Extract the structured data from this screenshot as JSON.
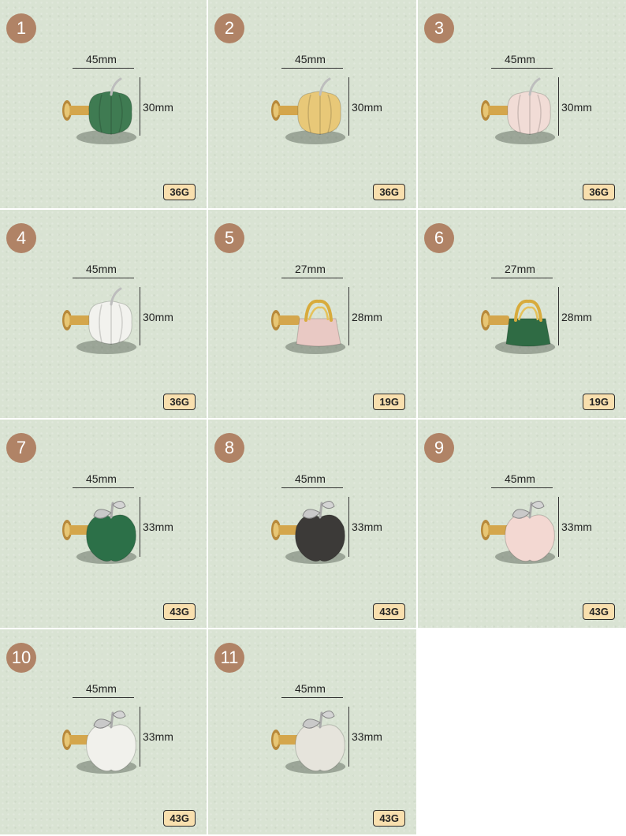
{
  "items": [
    {
      "number": "1",
      "width": "45mm",
      "height": "30mm",
      "weight": "36G",
      "shape": "pumpkin",
      "color": "#3f7b52"
    },
    {
      "number": "2",
      "width": "45mm",
      "height": "30mm",
      "weight": "36G",
      "shape": "pumpkin",
      "color": "#e8c878"
    },
    {
      "number": "3",
      "width": "45mm",
      "height": "30mm",
      "weight": "36G",
      "shape": "pumpkin",
      "color": "#f1dcd6"
    },
    {
      "number": "4",
      "width": "45mm",
      "height": "30mm",
      "weight": "36G",
      "shape": "pumpkin",
      "color": "#f2f2ee"
    },
    {
      "number": "5",
      "width": "27mm",
      "height": "28mm",
      "weight": "19G",
      "shape": "bag",
      "color": "#e9c9c4"
    },
    {
      "number": "6",
      "width": "27mm",
      "height": "28mm",
      "weight": "19G",
      "shape": "bag",
      "color": "#2f6b44"
    },
    {
      "number": "7",
      "width": "45mm",
      "height": "33mm",
      "weight": "43G",
      "shape": "apple",
      "color": "#2c7048"
    },
    {
      "number": "8",
      "width": "45mm",
      "height": "33mm",
      "weight": "43G",
      "shape": "apple",
      "color": "#3c3a38"
    },
    {
      "number": "9",
      "width": "45mm",
      "height": "33mm",
      "weight": "43G",
      "shape": "apple",
      "color": "#f3d8d2"
    },
    {
      "number": "10",
      "width": "45mm",
      "height": "33mm",
      "weight": "43G",
      "shape": "apple",
      "color": "#f1f1ec"
    },
    {
      "number": "11",
      "width": "45mm",
      "height": "33mm",
      "weight": "43G",
      "shape": "apple",
      "color": "#e6e4dc"
    }
  ]
}
